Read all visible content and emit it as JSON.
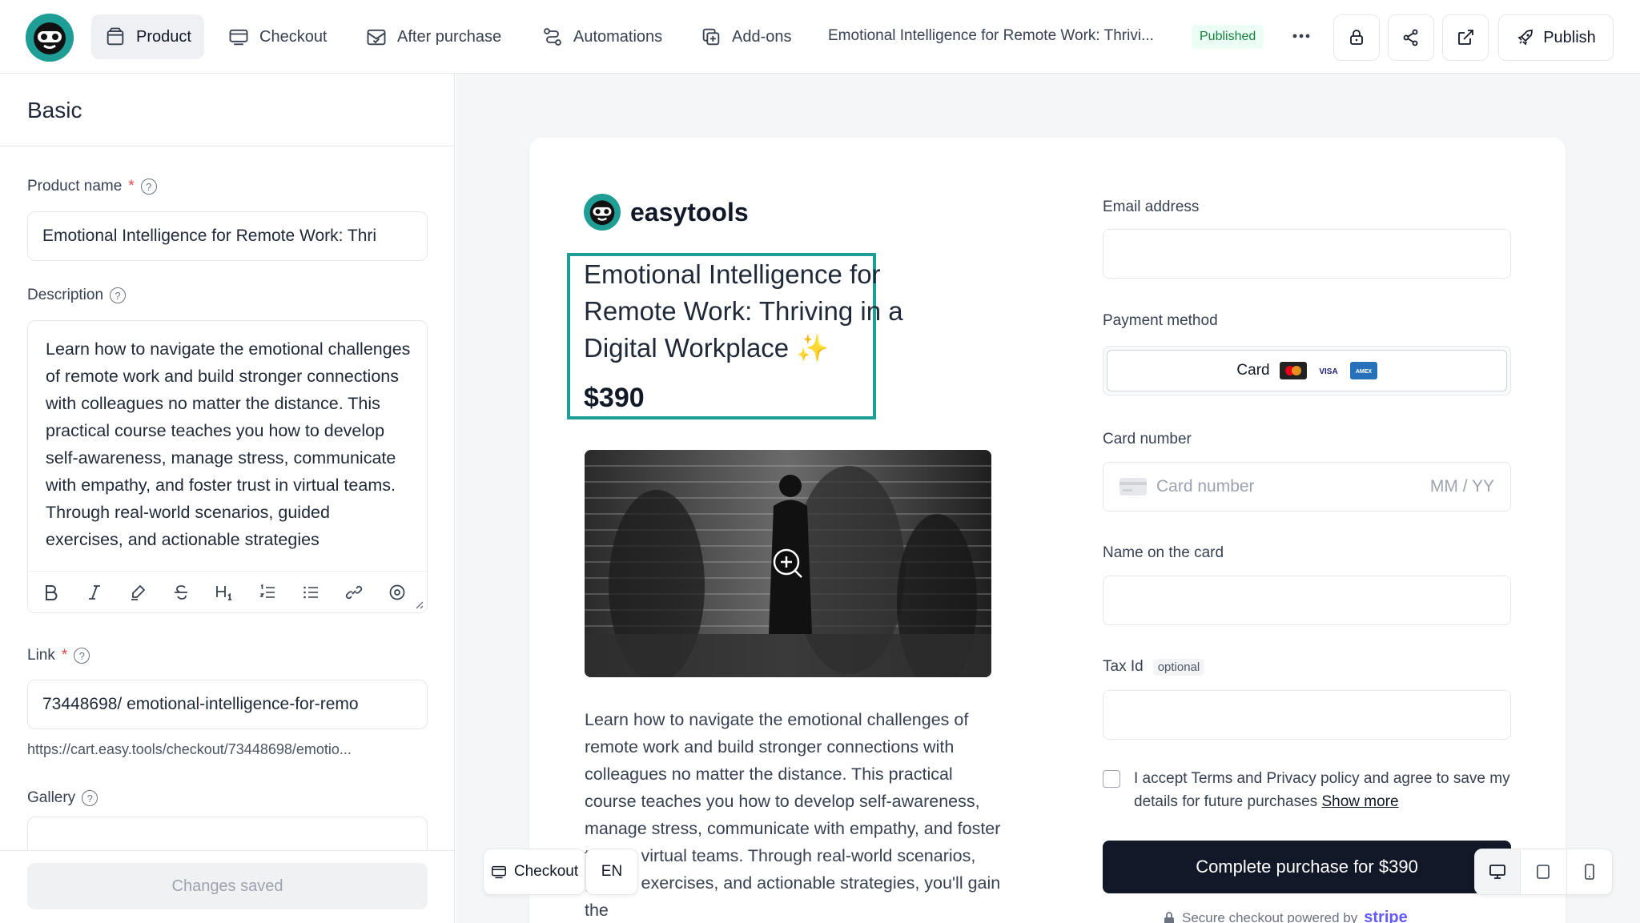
{
  "nav": {
    "tabs": [
      {
        "label": "Product",
        "icon": "package-icon"
      },
      {
        "label": "Checkout",
        "icon": "checkout-icon"
      },
      {
        "label": "After purchase",
        "icon": "mail-check-icon"
      },
      {
        "label": "Automations",
        "icon": "workflow-icon"
      },
      {
        "label": "Add-ons",
        "icon": "add-on-icon"
      }
    ],
    "breadcrumb": "Emotional Intelligence for Remote Work: Thrivi...",
    "status_badge": "Published",
    "publish_label": "Publish"
  },
  "left": {
    "section_title": "Basic",
    "product_name_label": "Product name",
    "product_name_value": "Emotional Intelligence for Remote Work: Thri",
    "description_label": "Description",
    "description_value": "Learn how to navigate the emotional challenges of remote work and build stronger connections with colleagues no matter the distance. This practical course teaches you how to develop self-awareness, manage stress, communicate with empathy, and foster trust in virtual teams. Through real-world scenarios, guided exercises, and actionable strategies",
    "link_label": "Link",
    "link_value": "73448698/ emotional-intelligence-for-remo",
    "link_url": "https://cart.easy.tools/checkout/73448698/emotio...",
    "gallery_label": "Gallery",
    "changes_saved": "Changes saved",
    "required_mark": "*",
    "help_mark": "?"
  },
  "preview": {
    "brand": "easytools",
    "title": "Emotional Intelligence for Remote Work: Thriving in a Digital Workplace",
    "title_emoji": "✨",
    "price": "$390",
    "description": "Learn how to navigate the emotional challenges of remote work and build stronger connections with colleagues no matter the distance. This practical course teaches you how to develop self-awareness, manage stress, communicate with empathy, and foster trust in virtual teams. Through real-world scenarios, guided exercises, and actionable strategies, you'll gain the",
    "email_label": "Email address",
    "payment_label": "Payment method",
    "card_option": "Card",
    "card_brands": {
      "visa": "VISA",
      "amex": "AMEX"
    },
    "card_number_label": "Card number",
    "card_number_placeholder": "Card number",
    "expiry_placeholder": "MM / YY",
    "name_label": "Name on the card",
    "tax_label": "Tax Id",
    "tax_optional": "optional",
    "terms_text": "I accept Terms and Privacy policy and agree to save my details for future purchases",
    "terms_link": "Show more",
    "complete_label": "Complete purchase for $390",
    "secure_text": "Secure checkout powered by",
    "secure_brand": "stripe",
    "float_checkout": "Checkout",
    "float_lang": "EN"
  },
  "colors": {
    "accent": "#1f9e96",
    "primary_button": "#111827",
    "published": "#15803d",
    "stripe": "#635bff"
  }
}
